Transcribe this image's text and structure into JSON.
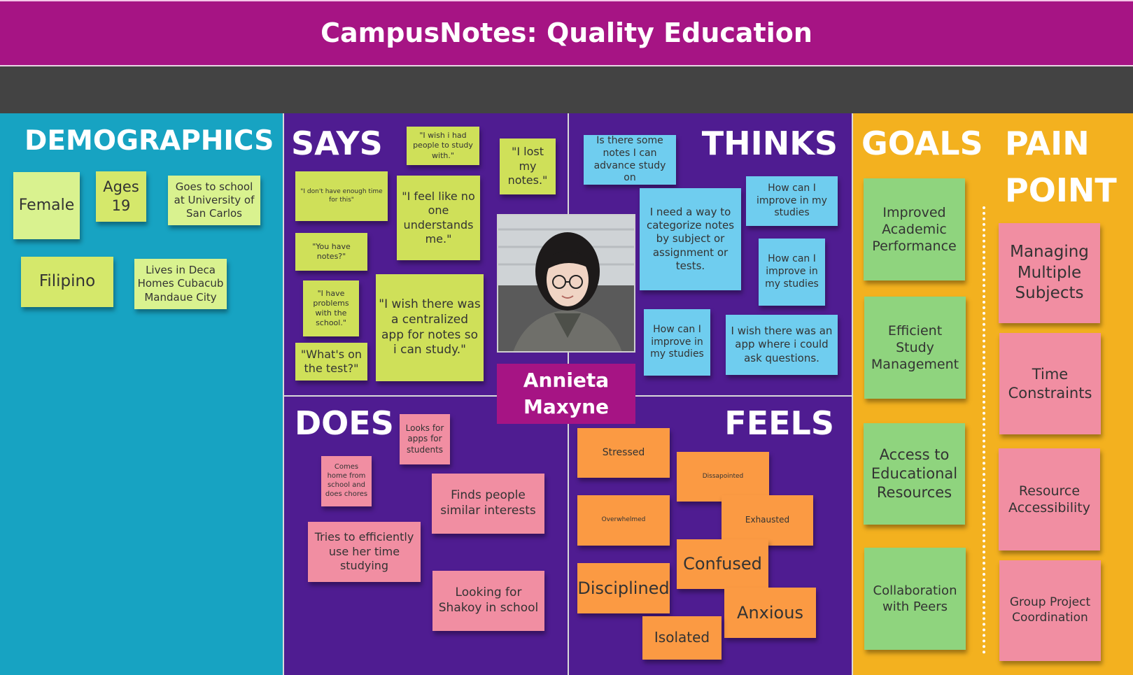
{
  "header": {
    "title": "CampusNotes: Quality Education"
  },
  "persona": {
    "name_line1": "Annieta",
    "name_line2": "Maxyne"
  },
  "demographics": {
    "heading": "DEMOGRAPHICS",
    "notes": [
      "Female",
      "Ages 19",
      "Goes to school at University of San Carlos",
      "Filipino",
      "Lives in Deca Homes Cubacub Mandaue City"
    ]
  },
  "says": {
    "heading": "SAYS",
    "notes": [
      "\"I wish i had people to study with.\"",
      "\"I lost my notes.\"",
      "\"I don't have enough time for this\"",
      "\"I feel like no one understands me.\"",
      "\"You have notes?\"",
      "\"I have problems with the school.\"",
      "\"I wish there was a centralized app for notes so i can study.\"",
      "\"What's on the test?\""
    ]
  },
  "thinks": {
    "heading": "THINKS",
    "notes": [
      "Is there some notes I can advance study on",
      "I need a way to categorize notes by subject or assignment or tests.",
      "How can I improve in my studies",
      "How can I improve in my studies",
      "How can I improve in my studies",
      "I wish there was an app where i could ask questions."
    ]
  },
  "does": {
    "heading": "DOES",
    "notes": [
      "Looks for apps for students",
      "Comes home from school and does chores",
      "Finds people similar interests",
      "Tries to efficiently use her time studying",
      "Looking for Shakoy in school"
    ]
  },
  "feels": {
    "heading": "FEELS",
    "notes": [
      "Stressed",
      "Dissapointed",
      "Overwhelmed",
      "Exhausted",
      "Confused",
      "Disciplined",
      "Anxious",
      "Isolated"
    ]
  },
  "goals": {
    "heading": "GOALS",
    "notes": [
      "Improved Academic Performance",
      "Efficient Study Management",
      "Access to Educational Resources",
      "Collaboration with Peers"
    ]
  },
  "pain_point": {
    "heading_line1": "PAIN",
    "heading_line2": "POINT",
    "notes": [
      "Managing Multiple Subjects",
      "Time Constraints",
      "Resource Accessibility",
      "Group Project Coordination"
    ]
  },
  "colors": {
    "header": "#a61484",
    "demographics_bg": "#17a3c2",
    "quadrant_bg": "#4f1c91",
    "goals_bg": "#f3b11f"
  }
}
